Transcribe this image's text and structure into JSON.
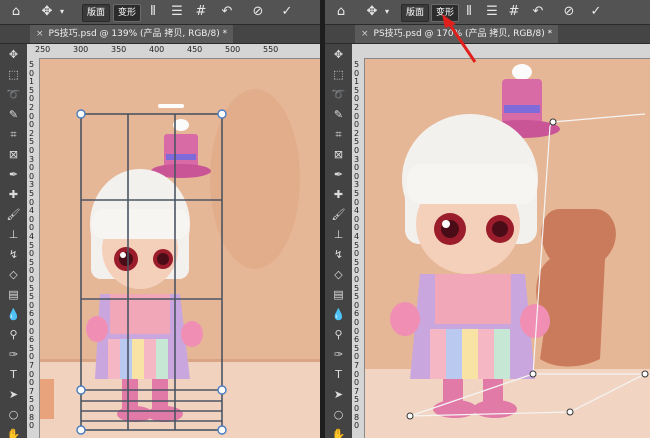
{
  "left": {
    "tab_close": "×",
    "tab_title": "PS技巧.psd @ 139% (产品 拷贝, RGB/8) *",
    "mode_label": "版面",
    "transform_label": "变形",
    "ruler_h": [
      "250",
      "300",
      "350",
      "400",
      "450",
      "500",
      "550"
    ],
    "ruler_v": [
      "5",
      "0",
      "1",
      "5",
      "0",
      "2",
      "0",
      "0",
      "2",
      "5",
      "0",
      "3",
      "0",
      "0",
      "3",
      "5",
      "0",
      "4",
      "0",
      "0",
      "4",
      "5",
      "0",
      "5",
      "0",
      "0",
      "5",
      "5",
      "0",
      "6",
      "0",
      "0",
      "6",
      "5",
      "0",
      "7",
      "0",
      "0",
      "7",
      "5",
      "0",
      "8",
      "0"
    ]
  },
  "right": {
    "tab_close": "×",
    "tab_title": "PS技巧.psd @ 170% (产品 拷贝, RGB/8) *",
    "mode_label": "版面",
    "transform_label": "变形",
    "ruler_v": [
      "5",
      "0",
      "1",
      "5",
      "0",
      "2",
      "0",
      "0",
      "2",
      "5",
      "0",
      "3",
      "0",
      "0",
      "3",
      "5",
      "0",
      "4",
      "0",
      "0",
      "4",
      "5",
      "0",
      "5",
      "0",
      "0",
      "5",
      "5",
      "0",
      "6",
      "0",
      "0",
      "6",
      "5",
      "0",
      "7",
      "0",
      "0",
      "7",
      "5",
      "0",
      "8",
      "0"
    ]
  },
  "collapse_glyph": "»",
  "icons": {
    "home": "home-icon",
    "move": "move-icon",
    "undo": "undo-icon",
    "cancel": "cancel-icon",
    "commit": "checkmark-icon"
  },
  "colors": {
    "canvas_bg": "#e6b796",
    "annotation_arrow": "#e0201c"
  }
}
